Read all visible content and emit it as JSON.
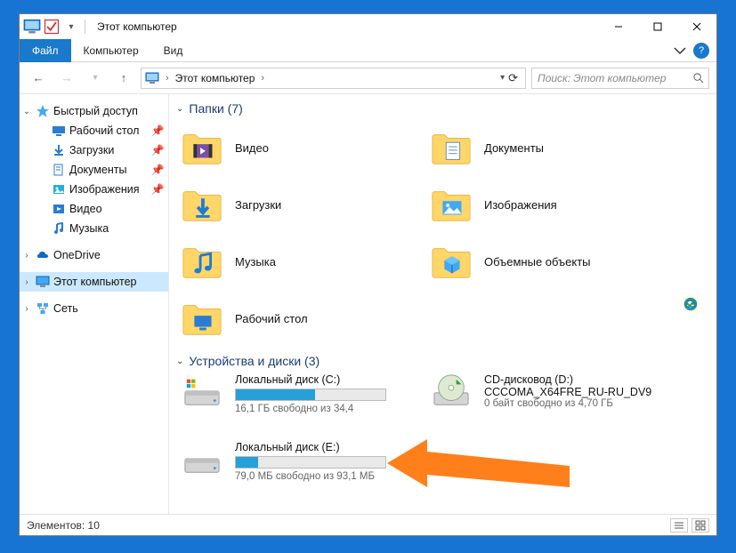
{
  "window": {
    "title": "Этот компьютер"
  },
  "ribbon": {
    "file": "Файл",
    "tabs": [
      "Компьютер",
      "Вид"
    ]
  },
  "breadcrumb": {
    "segments": [
      "Этот компьютер"
    ]
  },
  "search": {
    "placeholder": "Поиск: Этот компьютер"
  },
  "sidebar": {
    "quick_access": {
      "label": "Быстрый доступ",
      "items": [
        {
          "label": "Рабочий стол",
          "icon": "desktop",
          "pinned": true
        },
        {
          "label": "Загрузки",
          "icon": "downloads",
          "pinned": true
        },
        {
          "label": "Документы",
          "icon": "documents",
          "pinned": true
        },
        {
          "label": "Изображения",
          "icon": "pictures",
          "pinned": true
        },
        {
          "label": "Видео",
          "icon": "videos",
          "pinned": false
        },
        {
          "label": "Музыка",
          "icon": "music",
          "pinned": false
        }
      ]
    },
    "onedrive": {
      "label": "OneDrive"
    },
    "this_pc": {
      "label": "Этот компьютер"
    },
    "network": {
      "label": "Сеть"
    }
  },
  "groups": {
    "folders": {
      "title": "Папки (7)",
      "items": [
        {
          "label": "Видео",
          "icon": "videos",
          "overlay": "sync"
        },
        {
          "label": "Документы",
          "icon": "documents",
          "overlay": null
        },
        {
          "label": "Загрузки",
          "icon": "downloads",
          "overlay": "cloud"
        },
        {
          "label": "Изображения",
          "icon": "pictures",
          "overlay": null
        },
        {
          "label": "Музыка",
          "icon": "music",
          "overlay": null
        },
        {
          "label": "Объемные объекты",
          "icon": "3d",
          "overlay": null
        },
        {
          "label": "Рабочий стол",
          "icon": "desktop",
          "overlay": "ok"
        }
      ]
    },
    "drives": {
      "title": "Устройства и диски (3)",
      "items": [
        {
          "label": "Локальный диск (С:)",
          "sub": "16,1 ГБ свободно из 34,4",
          "fill_pct": 53,
          "icon": "hdd-win"
        },
        {
          "label": "CD-дисковод (D:) CCCOMA_X64FRE_RU-RU_DV9",
          "sub": "0 байт свободно из 4,70 ГБ",
          "fill_pct": null,
          "icon": "dvd"
        },
        {
          "label": "Локальный диск (Е:)",
          "sub": "79,0 МБ свободно из 93,1 МБ",
          "fill_pct": 15,
          "icon": "hdd"
        }
      ]
    }
  },
  "status": {
    "text": "Элементов: 10"
  }
}
